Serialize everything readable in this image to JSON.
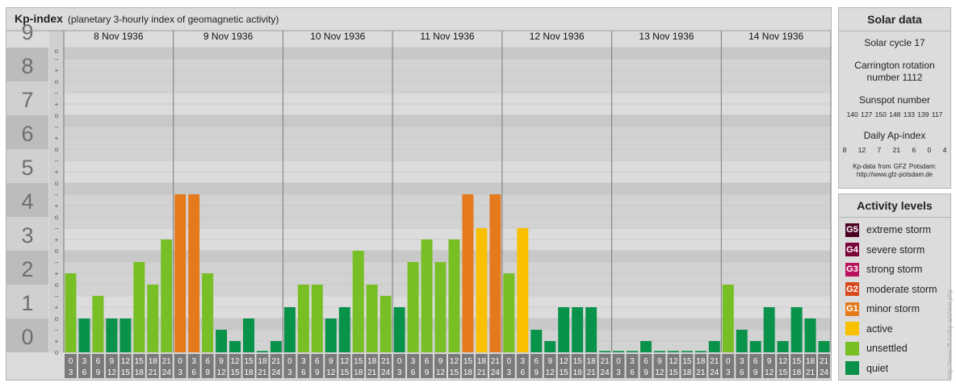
{
  "header": {
    "title": "Kp-index",
    "subtitle": "(planetary 3-hourly index of geomagnetic activity)"
  },
  "chart_data": {
    "type": "bar",
    "title": "Kp-index",
    "subtitle": "(planetary 3-hourly index of geomagnetic activity)",
    "ylim": [
      0,
      9
    ],
    "y_ticks": [
      "0",
      "1",
      "2",
      "3",
      "4",
      "5",
      "6",
      "7",
      "8",
      "9"
    ],
    "minor_tick_marks": [
      "o",
      "+",
      "–"
    ],
    "days": [
      "8 Nov 1936",
      "9 Nov 1936",
      "10 Nov 1936",
      "11 Nov 1936",
      "12 Nov 1936",
      "13 Nov 1936",
      "14 Nov 1936"
    ],
    "interval_start_labels": [
      "0",
      "3",
      "6",
      "9",
      "12",
      "15",
      "18",
      "21"
    ],
    "interval_end_labels": [
      "3",
      "6",
      "9",
      "12",
      "15",
      "18",
      "21",
      "24"
    ],
    "values": [
      [
        2.333,
        1.0,
        1.667,
        1.0,
        1.0,
        2.667,
        2.0,
        3.333
      ],
      [
        4.667,
        4.667,
        2.333,
        0.667,
        0.333,
        1.0,
        0.0,
        0.333
      ],
      [
        1.333,
        2.0,
        2.0,
        1.0,
        1.333,
        3.0,
        2.0,
        1.667
      ],
      [
        1.333,
        2.667,
        3.333,
        2.667,
        3.333,
        4.667,
        3.667,
        4.667
      ],
      [
        2.333,
        3.667,
        0.667,
        0.333,
        1.333,
        1.333,
        1.333,
        0.0
      ],
      [
        0.0,
        0.0,
        0.333,
        0.0,
        0.0,
        0.0,
        0.0,
        0.333
      ],
      [
        2.0,
        0.667,
        0.333,
        1.333,
        0.333,
        1.333,
        1.0,
        0.333
      ]
    ],
    "color_thresholds": [
      {
        "level": "quiet",
        "max": 1.5,
        "color": "#08924a"
      },
      {
        "level": "unsettled",
        "max": 3.5,
        "color": "#77bf24"
      },
      {
        "level": "active",
        "max": 4.5,
        "color": "#f9c000"
      },
      {
        "level": "minor storm",
        "max": 5.5,
        "color": "#e57a1c"
      }
    ],
    "grid": true
  },
  "solar": {
    "title": "Solar data",
    "cycle": "Solar cycle 17",
    "carrington_1": "Carrington rotation",
    "carrington_2": "number 1112",
    "sunspot_label": "Sunspot number",
    "sunspot_values": "140 127 150 148 133 139 117",
    "ap_label": "Daily Ap-index",
    "ap_values": "8 12 7 21 6 0 4",
    "source_1": "Kp-data from GFZ Potsdam:",
    "source_2": "http://www.gfz-potsdam.de"
  },
  "activity": {
    "title": "Activity levels",
    "levels": [
      {
        "badge": "G5",
        "label": "extreme storm",
        "color": "#4a0022"
      },
      {
        "badge": "G4",
        "label": "severe storm",
        "color": "#7a0538"
      },
      {
        "badge": "G3",
        "label": "strong storm",
        "color": "#b8135c"
      },
      {
        "badge": "G2",
        "label": "moderate storm",
        "color": "#d84a1c"
      },
      {
        "badge": "G1",
        "label": "minor storm",
        "color": "#e57a1c"
      },
      {
        "badge": "",
        "label": "active",
        "color": "#f9c000"
      },
      {
        "badge": "",
        "label": "unsettled",
        "color": "#77bf24"
      },
      {
        "badge": "",
        "label": "quiet",
        "color": "#08924a"
      }
    ]
  },
  "credit": "http://www.ffi.no/kp-archive.php"
}
